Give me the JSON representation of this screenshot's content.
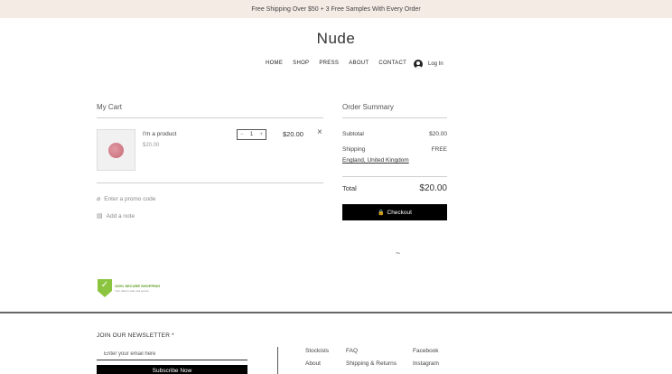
{
  "banner": {
    "text": "Free Shipping Over $50 + 3 Free Samples With Every Order"
  },
  "header": {
    "brand": "Nude",
    "nav": [
      "HOME",
      "SHOP",
      "PRESS",
      "ABOUT",
      "CONTACT"
    ],
    "login_label": "Log In"
  },
  "cart": {
    "title": "My Cart",
    "item": {
      "name": "I'm a product",
      "unit_price": "$20.00",
      "quantity": "1",
      "line_total": "$20.00"
    },
    "promo_label": "Enter a promo code",
    "note_label": "Add a note"
  },
  "summary": {
    "title": "Order Summary",
    "subtotal_label": "Subtotal",
    "subtotal_value": "$20.00",
    "shipping_label": "Shipping",
    "shipping_value": "FREE",
    "shipping_location": "England, United Kingdom",
    "total_label": "Total",
    "total_value": "$20.00",
    "checkout_label": "Checkout"
  },
  "badge": {
    "title": "100% SECURE SHOPPING",
    "subtitle": "Your data is safe and secure"
  },
  "footer": {
    "newsletter_title": "JOIN OUR NEWSLETTER *",
    "email_placeholder": "Enter your email here",
    "subscribe_label": "Subscribe Now",
    "col1": [
      "Stockists",
      "About"
    ],
    "col2": [
      "FAQ",
      "Shipping & Returns"
    ],
    "col3": [
      "Facebook",
      "Instagram"
    ]
  },
  "colors": {
    "banner_bg": "#f5ebe5",
    "button_bg": "#000000",
    "badge_green": "#8bc53f"
  }
}
